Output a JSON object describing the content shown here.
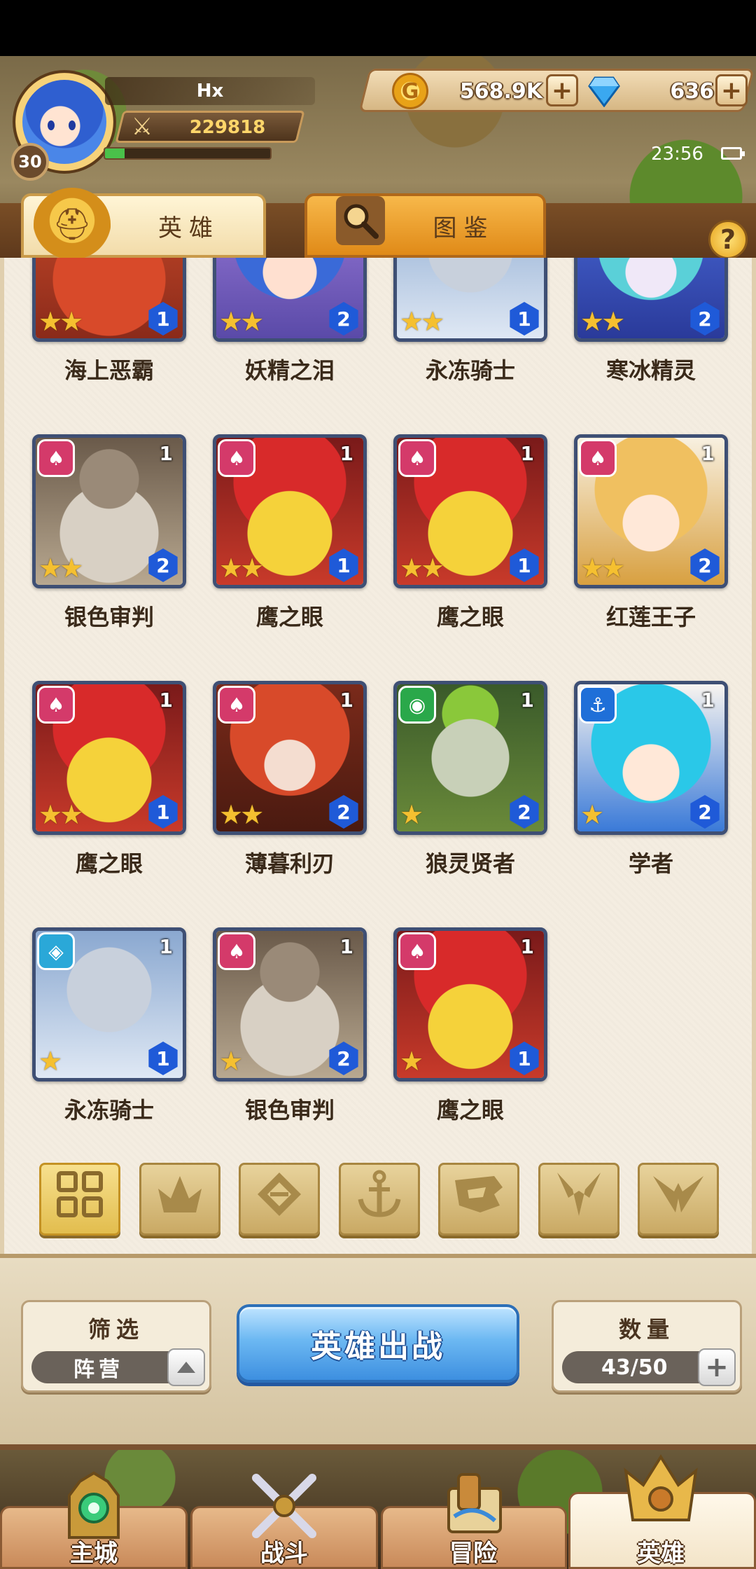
{
  "player": {
    "name": "Hx",
    "level": "30",
    "power": "229818",
    "exp_progress": 0.12
  },
  "currency": {
    "gold": "568.9K",
    "gems": "636"
  },
  "status": {
    "time": "23:56"
  },
  "tabs": [
    {
      "label": "英雄"
    },
    {
      "label": "图鉴"
    }
  ],
  "faction_colors": {
    "flame": "#d43a6a",
    "nature": "#2aa84a",
    "sea": "#1f6fd8",
    "order": "#2aa8d8"
  },
  "heroes": [
    {
      "name": "海上恶霸",
      "stars": 2,
      "rank": "1",
      "level": "",
      "faction": "",
      "art": "pirate"
    },
    {
      "name": "妖精之泪",
      "stars": 2,
      "rank": "2",
      "level": "",
      "faction": "",
      "art": "fairy"
    },
    {
      "name": "永冻骑士",
      "stars": 2,
      "rank": "1",
      "level": "",
      "faction": "",
      "art": "knight"
    },
    {
      "name": "寒冰精灵",
      "stars": 2,
      "rank": "2",
      "level": "",
      "faction": "",
      "art": "ice"
    },
    {
      "name": "银色审判",
      "stars": 2,
      "rank": "2",
      "level": "1",
      "faction": "flame",
      "art": "robot"
    },
    {
      "name": "鹰之眼",
      "stars": 2,
      "rank": "1",
      "level": "1",
      "faction": "flame",
      "art": "bird"
    },
    {
      "name": "鹰之眼",
      "stars": 2,
      "rank": "1",
      "level": "1",
      "faction": "flame",
      "art": "bird"
    },
    {
      "name": "红莲王子",
      "stars": 2,
      "rank": "2",
      "level": "1",
      "faction": "flame",
      "art": "prince"
    },
    {
      "name": "鹰之眼",
      "stars": 2,
      "rank": "1",
      "level": "1",
      "faction": "flame",
      "art": "bird"
    },
    {
      "name": "薄暮利刃",
      "stars": 2,
      "rank": "2",
      "level": "1",
      "faction": "flame",
      "art": "hood"
    },
    {
      "name": "狼灵贤者",
      "stars": 1,
      "rank": "2",
      "level": "1",
      "faction": "nature",
      "art": "owl"
    },
    {
      "name": "学者",
      "stars": 1,
      "rank": "2",
      "level": "1",
      "faction": "sea",
      "art": "scholar"
    },
    {
      "name": "永冻骑士",
      "stars": 1,
      "rank": "1",
      "level": "1",
      "faction": "order",
      "art": "knight"
    },
    {
      "name": "银色审判",
      "stars": 1,
      "rank": "2",
      "level": "1",
      "faction": "flame",
      "art": "robot"
    },
    {
      "name": "鹰之眼",
      "stars": 1,
      "rank": "1",
      "level": "1",
      "faction": "flame",
      "art": "bird"
    }
  ],
  "faction_filters": [
    {
      "icon": "all-grid-icon",
      "active": true
    },
    {
      "icon": "flame-faction-icon"
    },
    {
      "icon": "order-faction-icon"
    },
    {
      "icon": "anchor-faction-icon"
    },
    {
      "icon": "beast-faction-icon"
    },
    {
      "icon": "horn-faction-icon"
    },
    {
      "icon": "wing-faction-icon"
    }
  ],
  "filter": {
    "title": "筛选",
    "value": "阵营"
  },
  "deploy_button": "英雄出战",
  "count": {
    "title": "数量",
    "value": "43/50"
  },
  "nav": [
    {
      "label": "主城",
      "active": false
    },
    {
      "label": "战斗",
      "active": false
    },
    {
      "label": "冒险",
      "active": false
    },
    {
      "label": "英雄",
      "active": true
    }
  ]
}
